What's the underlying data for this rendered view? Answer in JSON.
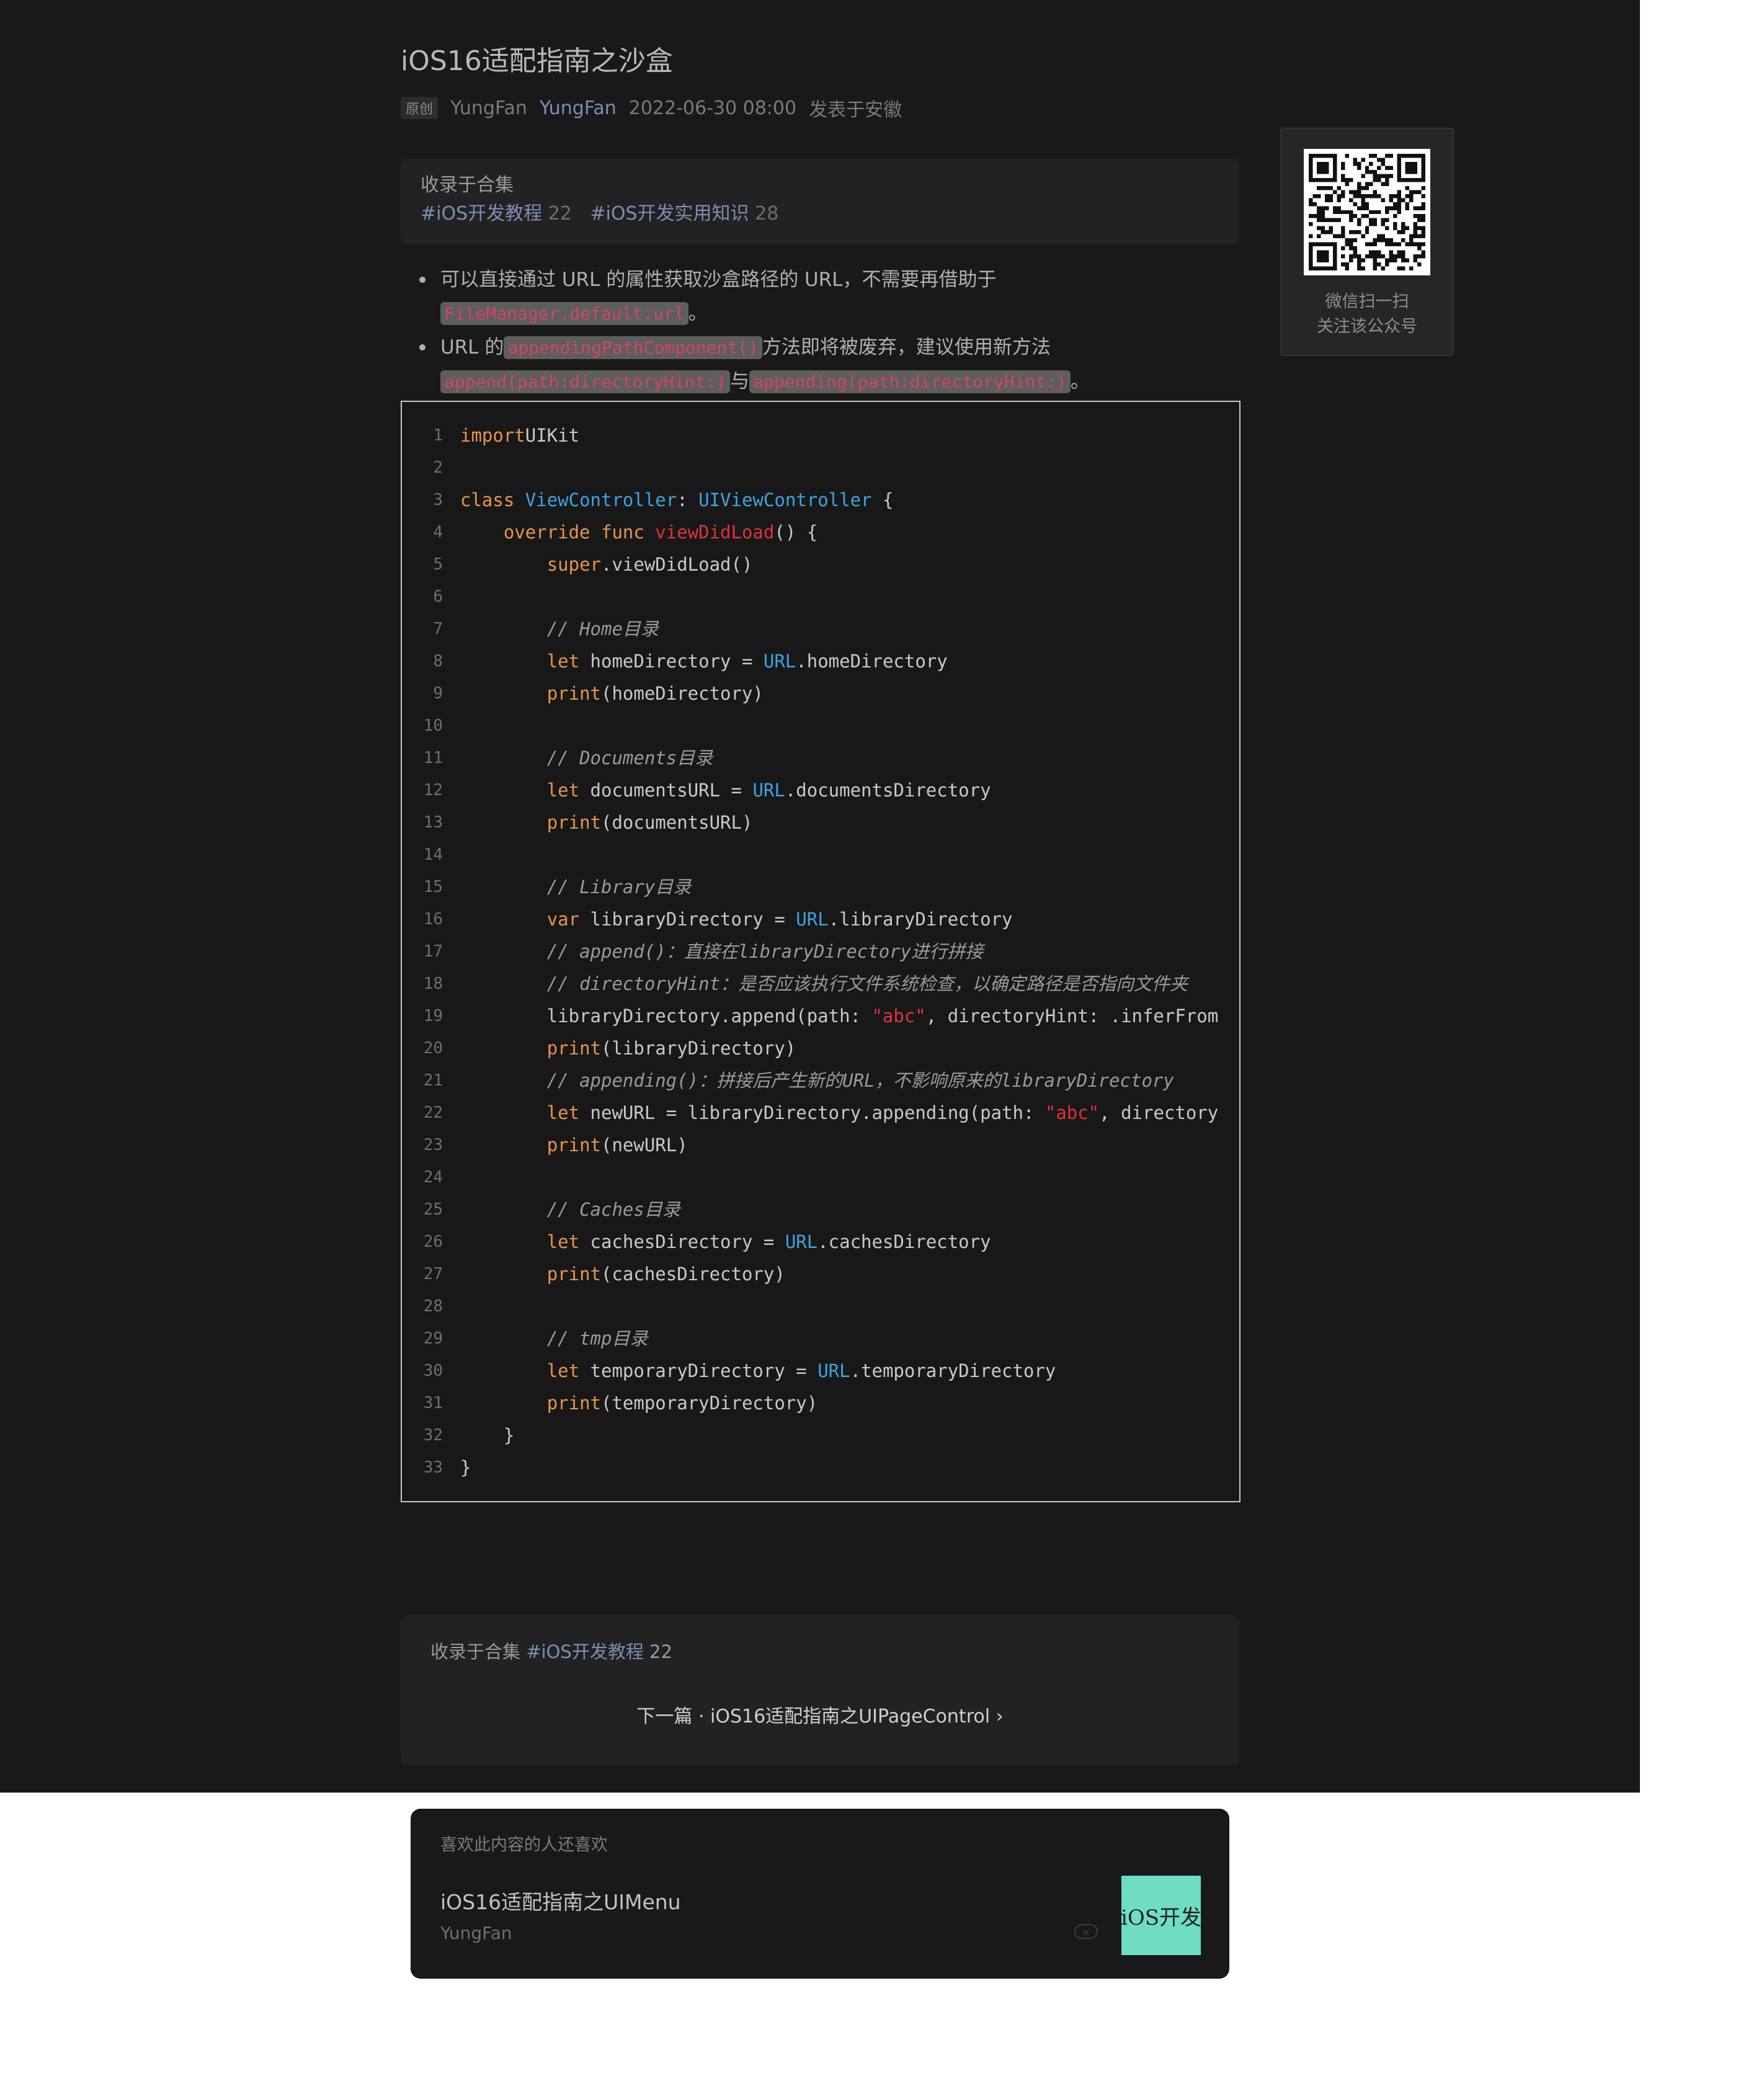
{
  "article": {
    "title": "iOS16适配指南之沙盒",
    "meta": {
      "badge": "原创",
      "author_name": "YungFan",
      "account_name": "YungFan",
      "date": "2022-06-30 08:00",
      "location": "发表于安徽"
    }
  },
  "collection_top": {
    "label": "收录于合集",
    "tags": [
      {
        "name": "#iOS开发教程",
        "count": "22"
      },
      {
        "name": "#iOS开发实用知识",
        "count": "28"
      }
    ]
  },
  "qr": {
    "caption_line1": "微信扫一扫",
    "caption_line2": "关注该公众号"
  },
  "bullets": [
    {
      "text_1": "可以直接通过 URL 的属性获取沙盒路径的 URL，不需要再借助于",
      "code_1": "FileManager.default.url",
      "text_2": "。"
    },
    {
      "text_1": "URL 的",
      "code_1": "appendingPathComponent()",
      "text_2": "方法即将被废弃，建议使用新方法",
      "code_2": "append(path:directoryHint:)",
      "text_3": "与",
      "code_3": "appending(path:directoryHint:)",
      "text_4": "。"
    }
  ],
  "code": {
    "lines": [
      [
        [
          "kw",
          "import"
        ],
        [
          "",
          "UIKit"
        ]
      ],
      [],
      [
        [
          "kw",
          "class"
        ],
        [
          "",
          ""
        ],
        [
          "ty",
          "ViewController"
        ],
        [
          "",
          ": "
        ],
        [
          "ty",
          "UIViewController"
        ],
        [
          "",
          " {"
        ]
      ],
      [
        [
          "",
          "    "
        ],
        [
          "kw",
          "override func"
        ],
        [
          "",
          ""
        ],
        [
          "fn",
          "viewDidLoad"
        ],
        [
          "",
          "() {"
        ]
      ],
      [
        [
          "",
          "        "
        ],
        [
          "kw",
          "super"
        ],
        [
          "",
          ".viewDidLoad()"
        ]
      ],
      [],
      [
        [
          "",
          "        "
        ],
        [
          "cm",
          "// Home目录"
        ]
      ],
      [
        [
          "",
          "        "
        ],
        [
          "kw",
          "let"
        ],
        [
          "",
          " homeDirectory = "
        ],
        [
          "ty",
          "URL"
        ],
        [
          "",
          ".homeDirectory"
        ]
      ],
      [
        [
          "",
          "        "
        ],
        [
          "kw",
          "print"
        ],
        [
          "",
          "(homeDirectory)"
        ]
      ],
      [],
      [
        [
          "",
          "        "
        ],
        [
          "cm",
          "// Documents目录"
        ]
      ],
      [
        [
          "",
          "        "
        ],
        [
          "kw",
          "let"
        ],
        [
          "",
          " documentsURL = "
        ],
        [
          "ty",
          "URL"
        ],
        [
          "",
          ".documentsDirectory"
        ]
      ],
      [
        [
          "",
          "        "
        ],
        [
          "kw",
          "print"
        ],
        [
          "",
          "(documentsURL)"
        ]
      ],
      [],
      [
        [
          "",
          "        "
        ],
        [
          "cm",
          "// Library目录"
        ]
      ],
      [
        [
          "",
          "        "
        ],
        [
          "kw",
          "var"
        ],
        [
          "",
          " libraryDirectory = "
        ],
        [
          "ty",
          "URL"
        ],
        [
          "",
          ".libraryDirectory"
        ]
      ],
      [
        [
          "",
          "        "
        ],
        [
          "cm",
          "// append()：直接在libraryDirectory进行拼接"
        ]
      ],
      [
        [
          "",
          "        "
        ],
        [
          "cm",
          "// directoryHint：是否应该执行文件系统检查，以确定路径是否指向文件夹"
        ]
      ],
      [
        [
          "",
          "        libraryDirectory.append(path: "
        ],
        [
          "st",
          "\"abc\""
        ],
        [
          "",
          ", directoryHint: .inferFrom"
        ]
      ],
      [
        [
          "",
          "        "
        ],
        [
          "kw",
          "print"
        ],
        [
          "",
          "(libraryDirectory)"
        ]
      ],
      [
        [
          "",
          "        "
        ],
        [
          "cm",
          "// appending()：拼接后产生新的URL，不影响原来的libraryDirectory"
        ]
      ],
      [
        [
          "",
          "        "
        ],
        [
          "kw",
          "let"
        ],
        [
          "",
          " newURL = libraryDirectory.appending(path: "
        ],
        [
          "st",
          "\"abc\""
        ],
        [
          "",
          ", directory"
        ]
      ],
      [
        [
          "",
          "        "
        ],
        [
          "kw",
          "print"
        ],
        [
          "",
          "(newURL)"
        ]
      ],
      [],
      [
        [
          "",
          "        "
        ],
        [
          "cm",
          "// Caches目录"
        ]
      ],
      [
        [
          "",
          "        "
        ],
        [
          "kw",
          "let"
        ],
        [
          "",
          " cachesDirectory = "
        ],
        [
          "ty",
          "URL"
        ],
        [
          "",
          ".cachesDirectory"
        ]
      ],
      [
        [
          "",
          "        "
        ],
        [
          "kw",
          "print"
        ],
        [
          "",
          "(cachesDirectory)"
        ]
      ],
      [],
      [
        [
          "",
          "        "
        ],
        [
          "cm",
          "// tmp目录"
        ]
      ],
      [
        [
          "",
          "        "
        ],
        [
          "kw",
          "let"
        ],
        [
          "",
          " temporaryDirectory = "
        ],
        [
          "ty",
          "URL"
        ],
        [
          "",
          ".temporaryDirectory"
        ]
      ],
      [
        [
          "",
          "        "
        ],
        [
          "kw",
          "print"
        ],
        [
          "",
          "(temporaryDirectory)"
        ]
      ],
      [
        [
          "",
          "    }"
        ]
      ],
      [
        [
          "",
          "}"
        ]
      ]
    ]
  },
  "collection_bottom": {
    "label": "收录于合集",
    "tag_name": "#iOS开发教程",
    "tag_count": "22",
    "next": "下一篇 · iOS16适配指南之UIPageControl ›"
  },
  "recommend": {
    "heading": "喜欢此内容的人还喜欢",
    "title": "iOS16适配指南之UIMenu",
    "author": "YungFan",
    "close_label": "×",
    "thumb_text": "iOS开发"
  },
  "colors": {
    "background": "#191919",
    "link": "#7b8fb2",
    "keyword": "#e6954a",
    "type": "#3ea3e0",
    "string": "#e0323d",
    "thumb": "#6fdcc4"
  }
}
